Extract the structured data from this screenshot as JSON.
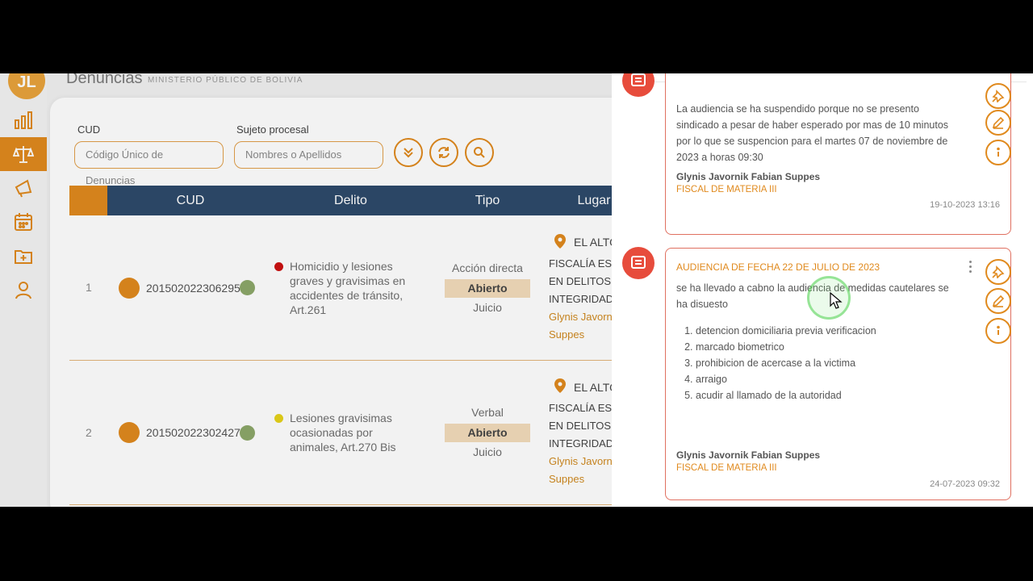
{
  "app": {
    "logo_text": "JL",
    "title": "Denuncias",
    "subtitle": "MINISTERIO PÚBLICO DE BOLIVIA"
  },
  "sidebar": {
    "items": [
      {
        "icon": "bar-chart-icon",
        "active": false
      },
      {
        "icon": "scales-icon",
        "active": true
      },
      {
        "icon": "megaphone-icon",
        "active": false
      },
      {
        "icon": "calendar-icon",
        "active": false
      },
      {
        "icon": "folder-plus-icon",
        "active": false
      },
      {
        "icon": "user-icon",
        "active": false
      }
    ]
  },
  "filters": {
    "cud_label": "CUD",
    "cud_placeholder": "Código Único de Denuncias",
    "sujeto_label": "Sujeto procesal",
    "sujeto_placeholder": "Nombres o Apellidos",
    "buttons": [
      "chevrons-down-icon",
      "refresh-icon",
      "search-icon"
    ]
  },
  "table": {
    "headers": [
      "CUD",
      "Delito",
      "Tipo",
      "Lugar"
    ],
    "rows": [
      {
        "num": "1",
        "cud": "201502022306295",
        "delito": "Homicidio y lesiones graves y gravisimas en accidentes de tránsito, Art.261",
        "delito_color": "#cc1111",
        "tipo": "Acción directa",
        "estado": "Abierto",
        "etapa": "Juicio",
        "lugar": "EL ALTO",
        "fiscalia_lines": [
          "FISCALÍA ESP",
          "EN DELITOS C",
          "INTEGRIDAD F"
        ],
        "fiscal_lines": [
          "Glynis Javorn",
          "Suppes"
        ]
      },
      {
        "num": "2",
        "cud": "201502022302427",
        "delito": "Lesiones gravisimas ocasionadas por animales, Art.270 Bis",
        "delito_color": "#e6d21a",
        "tipo": "Verbal",
        "estado": "Abierto",
        "etapa": "Juicio",
        "lugar": "EL ALTO",
        "fiscalia_lines": [
          "FISCALÍA ESP",
          "EN DELITOS C",
          "INTEGRIDAD F"
        ],
        "fiscal_lines": [
          "Glynis Javorn",
          "Suppes"
        ]
      }
    ]
  },
  "notes": [
    {
      "title": "",
      "text": "La audiencia se ha suspendido porque no se presento sindicado a pesar de haber esperado por mas de 10 minutos por lo que se suspencion para el martes 07 de noviembre de 2023 a horas 09:30",
      "list": [],
      "author": "Glynis Javornik Fabian Suppes",
      "role": "FISCAL DE MATERIA III",
      "date": "19-10-2023 13:16"
    },
    {
      "title": "AUDIENCIA DE FECHA 22 DE JULIO DE 2023",
      "text": "se ha llevado a cabno la audiencia de medidas cautelares se ha disuesto",
      "list": [
        "detencion domiciliaria previa verificacion",
        "marcado biometrico",
        "prohibicion de acercase a la victima",
        "arraigo",
        "acudir al llamado de la autoridad"
      ],
      "author": "Glynis Javornik Fabian Suppes",
      "role": "FISCAL DE MATERIA III",
      "date": "24-07-2023 09:32"
    }
  ],
  "colors": {
    "accent": "#e08a1e",
    "header_bg": "#2e4a6b",
    "note_border": "#e07060",
    "avatar": "#e74c3c"
  }
}
